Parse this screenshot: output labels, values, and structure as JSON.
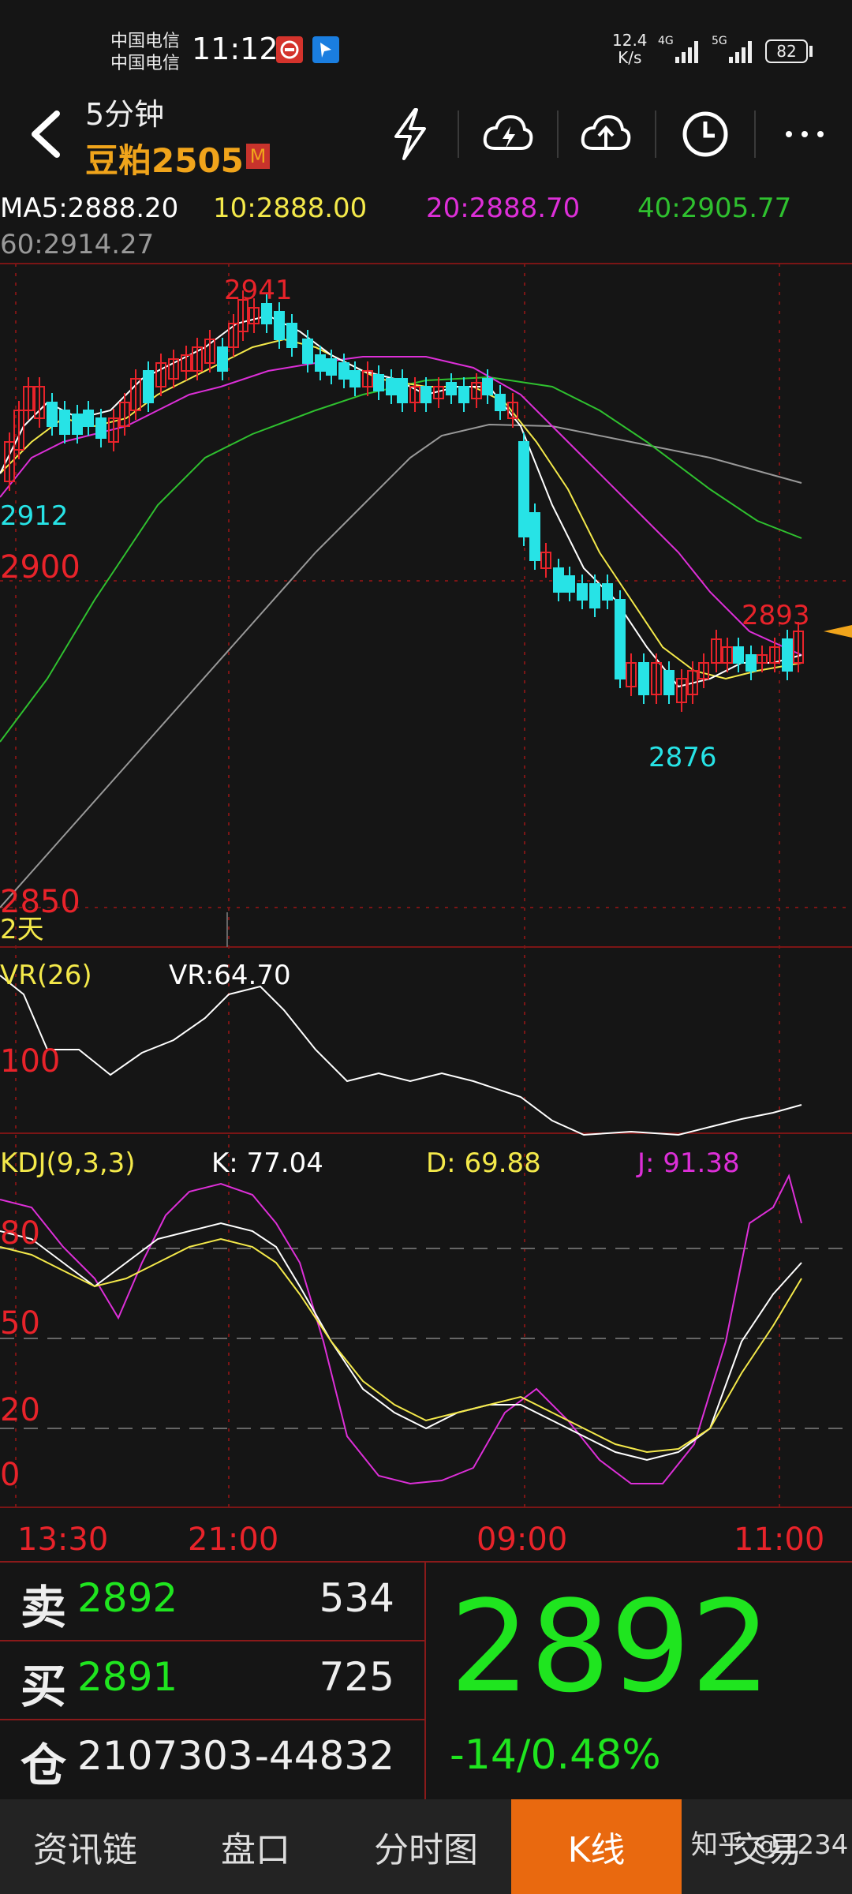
{
  "status_bar": {
    "carrier1": "中国电信",
    "carrier2": "中国电信",
    "time": "11:12",
    "net_speed_top": "12.4",
    "net_speed_bottom": "K/s",
    "net1": "4G",
    "net2": "5G",
    "battery": "82"
  },
  "header": {
    "period": "5分钟",
    "symbol": "豆粕2505",
    "badge": "M"
  },
  "ma": {
    "ma5": "MA5:2888.20",
    "ma10": "10:2888.00",
    "ma20": "20:2888.70",
    "ma40": "40:2905.77",
    "ma60": "60:2914.27"
  },
  "price_labels": {
    "high": "2941",
    "low": "2876",
    "last_high": "2893",
    "left_2912": "2912",
    "left_2900": "2900",
    "left_2850": "2850",
    "span": "2天"
  },
  "vr": {
    "title": "VR(26)",
    "value": "VR:64.70",
    "level": "100"
  },
  "kdj": {
    "title": "KDJ(9,3,3)",
    "k": "K: 77.04",
    "d": "D: 69.88",
    "j": "J: 91.38",
    "levels": [
      "80",
      "50",
      "20",
      "0"
    ]
  },
  "time_axis": [
    "13:30",
    "21:00",
    "09:00",
    "11:00"
  ],
  "quote": {
    "sell_label": "卖",
    "sell_price": "2892",
    "sell_vol": "534",
    "buy_label": "买",
    "buy_price": "2891",
    "buy_vol": "725",
    "oi_label": "仓",
    "oi": "2107303",
    "oi_change": "-44832",
    "last": "2892",
    "change": "-14/0.48%"
  },
  "tabs": [
    "资讯链",
    "盘口",
    "分时图",
    "K线",
    "交易"
  ],
  "watermark": "知乎 @1234",
  "colors": {
    "up": "#e8232a",
    "down": "#27e3e6",
    "ma5": "#ffffff",
    "ma10": "#f4e94a",
    "ma20": "#dd2fd8",
    "ma40": "#2fc12f",
    "ma60": "#999999",
    "accent": "#e9690f"
  }
}
